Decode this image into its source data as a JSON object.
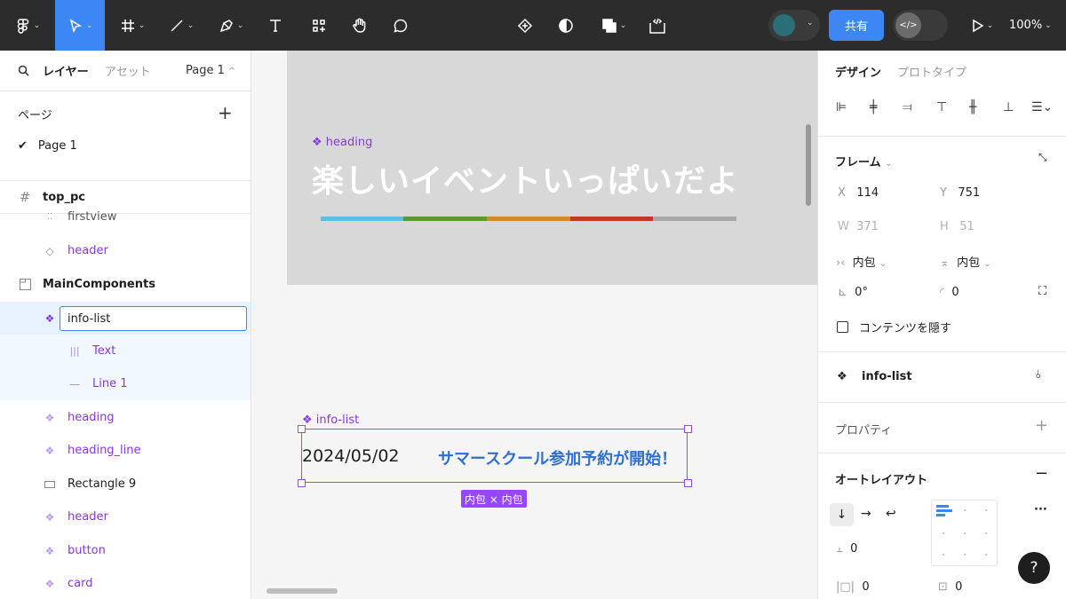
{
  "toolbar": {
    "tools": [
      "main-menu",
      "move",
      "frame",
      "line",
      "pen",
      "text",
      "resources",
      "hand",
      "comment"
    ],
    "center_tools": [
      "component",
      "mask",
      "boolean",
      "dev-mode"
    ],
    "share_label": "共有",
    "zoom": "100%",
    "dev_icon": "</>"
  },
  "left_panel": {
    "search_icon": "search-icon",
    "tab_layers": "レイヤー",
    "tab_assets": "アセット",
    "current_page": "Page 1",
    "pages_label": "ページ",
    "page_item": "Page 1",
    "layers": [
      {
        "label": "top_pc",
        "icon": "frame-icon",
        "bold": true
      },
      {
        "label": "firstview",
        "icon": "dashed-frame-icon"
      },
      {
        "label": "header",
        "icon": "instance-icon"
      },
      {
        "label": "MainComponents",
        "icon": "section-icon",
        "bold": true
      },
      {
        "label": "info-list",
        "icon": "component-icon"
      },
      {
        "label": "Text",
        "icon": "autolayout-icon"
      },
      {
        "label": "Line 1",
        "icon": "line-icon"
      },
      {
        "label": "heading",
        "icon": "component-icon"
      },
      {
        "label": "heading_line",
        "icon": "component-icon"
      },
      {
        "label": "Rectangle 9",
        "icon": "rectangle-icon"
      },
      {
        "label": "header",
        "icon": "component-icon"
      },
      {
        "label": "button",
        "icon": "component-icon"
      },
      {
        "label": "card",
        "icon": "component-icon"
      }
    ]
  },
  "canvas": {
    "heading_label": "heading",
    "heading_text": "楽しいイベントいっぱいだよ",
    "stripe_colors": [
      "#5bc0de",
      "#5a9a35",
      "#cf8a2e",
      "#c0392b",
      "#a8a8a8"
    ],
    "info_label": "info-list",
    "date": "2024/05/02",
    "info_text": "サマースクール参加予約が開始！",
    "size_badge": "内包 × 内包"
  },
  "right_panel": {
    "tab_design": "デザイン",
    "tab_prototype": "プロトタイプ",
    "frame_label": "フレーム",
    "x_label": "X",
    "x": "114",
    "y_label": "Y",
    "y": "751",
    "w_label": "W",
    "w": "371",
    "h_label": "H",
    "h": "51",
    "hug_w": "内包",
    "hug_h": "内包",
    "rotation": "0°",
    "radius": "0",
    "clip_label": "コンテンツを隠す",
    "component_name": "info-list",
    "properties_label": "プロパティ",
    "autolayout_label": "オートレイアウト",
    "gap": "0",
    "pad_h": "0",
    "pad_v": "0"
  },
  "help_label": "?"
}
